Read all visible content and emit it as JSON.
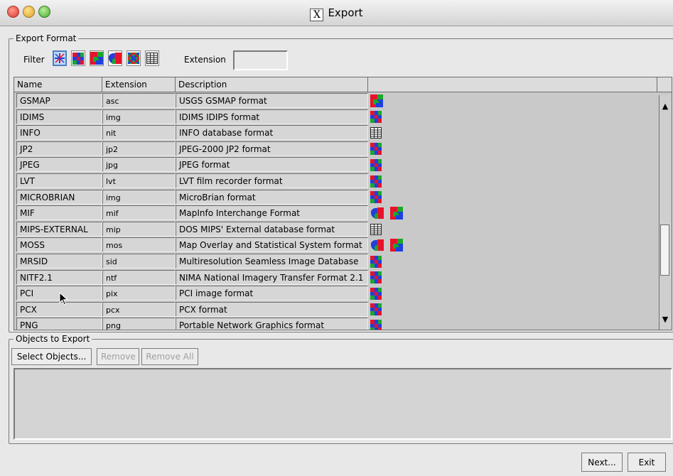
{
  "window": {
    "title": "Export",
    "title_icon": "X"
  },
  "export_format": {
    "legend": "Export Format",
    "filter_label": "Filter",
    "filter_buttons": [
      {
        "icon": "all-types-icon",
        "active": true
      },
      {
        "icon": "raster-icon",
        "active": false
      },
      {
        "icon": "vector-icon",
        "active": false
      },
      {
        "icon": "cad-icon",
        "active": false
      },
      {
        "icon": "tin-icon",
        "active": false
      },
      {
        "icon": "database-icon",
        "active": false
      }
    ],
    "extension_label": "Extension",
    "extension_value": ""
  },
  "table": {
    "headers": [
      "Name",
      "Extension",
      "Description",
      ""
    ],
    "rows": [
      {
        "name": "GSMAP",
        "ext": "asc",
        "desc": "USGS GSMAP format",
        "icons": [
          "vector"
        ]
      },
      {
        "name": "IDIMS",
        "ext": "img",
        "desc": "IDIMS IDIPS format",
        "icons": [
          "raster"
        ]
      },
      {
        "name": "INFO",
        "ext": "nit",
        "desc": "INFO database format",
        "icons": [
          "database"
        ]
      },
      {
        "name": "JP2",
        "ext": "jp2",
        "desc": "JPEG-2000 JP2 format",
        "icons": [
          "raster"
        ]
      },
      {
        "name": "JPEG",
        "ext": "jpg",
        "desc": "JPEG format",
        "icons": [
          "raster"
        ]
      },
      {
        "name": "LVT",
        "ext": "lvt",
        "desc": "LVT film recorder format",
        "icons": [
          "raster"
        ]
      },
      {
        "name": "MICROBRIAN",
        "ext": "img",
        "desc": "MicroBrian format",
        "icons": [
          "raster"
        ]
      },
      {
        "name": "MIF",
        "ext": "mif",
        "desc": "MapInfo Interchange Format",
        "icons": [
          "cad",
          "vector"
        ]
      },
      {
        "name": "MIPS-EXTERNAL",
        "ext": "mip",
        "desc": "DOS MIPS' External database format",
        "icons": [
          "database"
        ]
      },
      {
        "name": "MOSS",
        "ext": "mos",
        "desc": "Map Overlay and Statistical System format",
        "icons": [
          "cad",
          "vector"
        ]
      },
      {
        "name": "MRSID",
        "ext": "sid",
        "desc": "Multiresolution Seamless Image Database",
        "icons": [
          "raster"
        ]
      },
      {
        "name": "NITF2.1",
        "ext": "ntf",
        "desc": "NIMA National Imagery Transfer Format 2.1",
        "icons": [
          "raster"
        ]
      },
      {
        "name": "PCI",
        "ext": "pix",
        "desc": "PCI image format",
        "icons": [
          "raster"
        ]
      },
      {
        "name": "PCX",
        "ext": "pcx",
        "desc": "PCX format",
        "icons": [
          "raster"
        ]
      },
      {
        "name": "PNG",
        "ext": "png",
        "desc": "Portable Network Graphics format",
        "icons": [
          "raster"
        ]
      }
    ]
  },
  "objects": {
    "legend": "Objects to Export",
    "select_label": "Select Objects...",
    "remove_label": "Remove",
    "remove_all_label": "Remove All"
  },
  "footer": {
    "next_label": "Next...",
    "exit_label": "Exit"
  },
  "colors": {
    "red": "#e8112a",
    "blue": "#1f3fe0",
    "green": "#1aa82a"
  }
}
